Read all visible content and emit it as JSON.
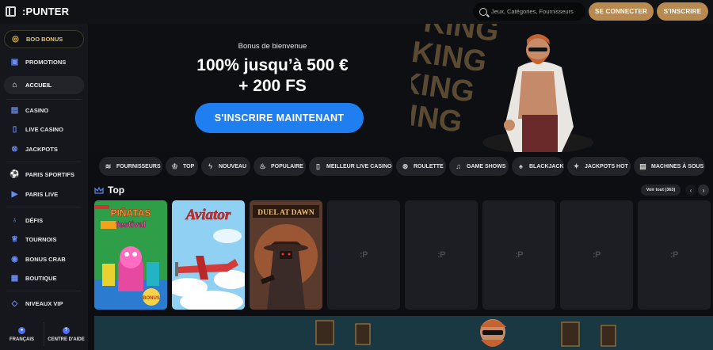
{
  "header": {
    "logo": "PUNTER",
    "logo_prefix": ":",
    "search_placeholder": "Jeux, Catégories, Fournisseurs",
    "login_label": "SE CONNECTER",
    "signup_label": "S'INSCRIRE"
  },
  "sidebar": {
    "items": [
      {
        "label": "BOO BONUS",
        "icon": "bonus-icon"
      },
      {
        "label": "PROMOTIONS",
        "icon": "gift-icon"
      },
      {
        "label": "ACCUEIL",
        "icon": "home-icon"
      },
      {
        "label": "CASINO",
        "icon": "slot-icon"
      },
      {
        "label": "LIVE CASINO",
        "icon": "live-icon"
      },
      {
        "label": "JACKPOTS",
        "icon": "jackpot-icon"
      },
      {
        "label": "PARIS SPORTIFS",
        "icon": "football-icon"
      },
      {
        "label": "PARIS LIVE",
        "icon": "live-bet-icon"
      },
      {
        "label": "DÉFIS",
        "icon": "challenge-icon"
      },
      {
        "label": "TOURNOIS",
        "icon": "trophy-icon"
      },
      {
        "label": "BONUS CRAB",
        "icon": "crab-icon"
      },
      {
        "label": "BOUTIQUE",
        "icon": "shop-icon"
      },
      {
        "label": "NIVEAUX VIP",
        "icon": "diamond-icon"
      }
    ],
    "bottom": [
      {
        "label": "FRANÇAIS",
        "icon": "globe-icon"
      },
      {
        "label": "CENTRE D'AIDE",
        "icon": "help-icon"
      }
    ]
  },
  "hero": {
    "subtitle": "Bonus de bienvenue",
    "title_line1": "100% jusqu’à 500 €",
    "title_line2": "+ 200 FS",
    "cta": "S'INSCRIRE MAINTENANT",
    "background_word": "KING"
  },
  "chips": [
    {
      "label": "FOURNISSEURS",
      "icon": "layers-icon"
    },
    {
      "label": "TOP",
      "icon": "crown-icon"
    },
    {
      "label": "NOUVEAU",
      "icon": "bolt-icon"
    },
    {
      "label": "POPULAIRE",
      "icon": "flame-icon"
    },
    {
      "label": "MEILLEUR LIVE CASINO",
      "icon": "live-icon"
    },
    {
      "label": "ROULETTE",
      "icon": "roulette-icon"
    },
    {
      "label": "GAME SHOWS",
      "icon": "mic-icon"
    },
    {
      "label": "BLACKJACK",
      "icon": "spade-icon"
    },
    {
      "label": "JACKPOTS HOT",
      "icon": "hot-icon"
    },
    {
      "label": "MACHINES À SOUS",
      "icon": "slot-icon"
    }
  ],
  "top": {
    "title": "Top",
    "see_all": "Voir tout (363)",
    "games": [
      {
        "name": "PIÑATAS FESTIVAL",
        "badge": "BONUS"
      },
      {
        "name": "Aviator"
      },
      {
        "name": "DUEL AT DAWN"
      }
    ],
    "placeholder_logo": ":P"
  },
  "colors": {
    "accent_gold": "#b88a4f",
    "accent_blue": "#1f7ef0",
    "background": "#0d0e12",
    "sidebar": "#16171c"
  }
}
